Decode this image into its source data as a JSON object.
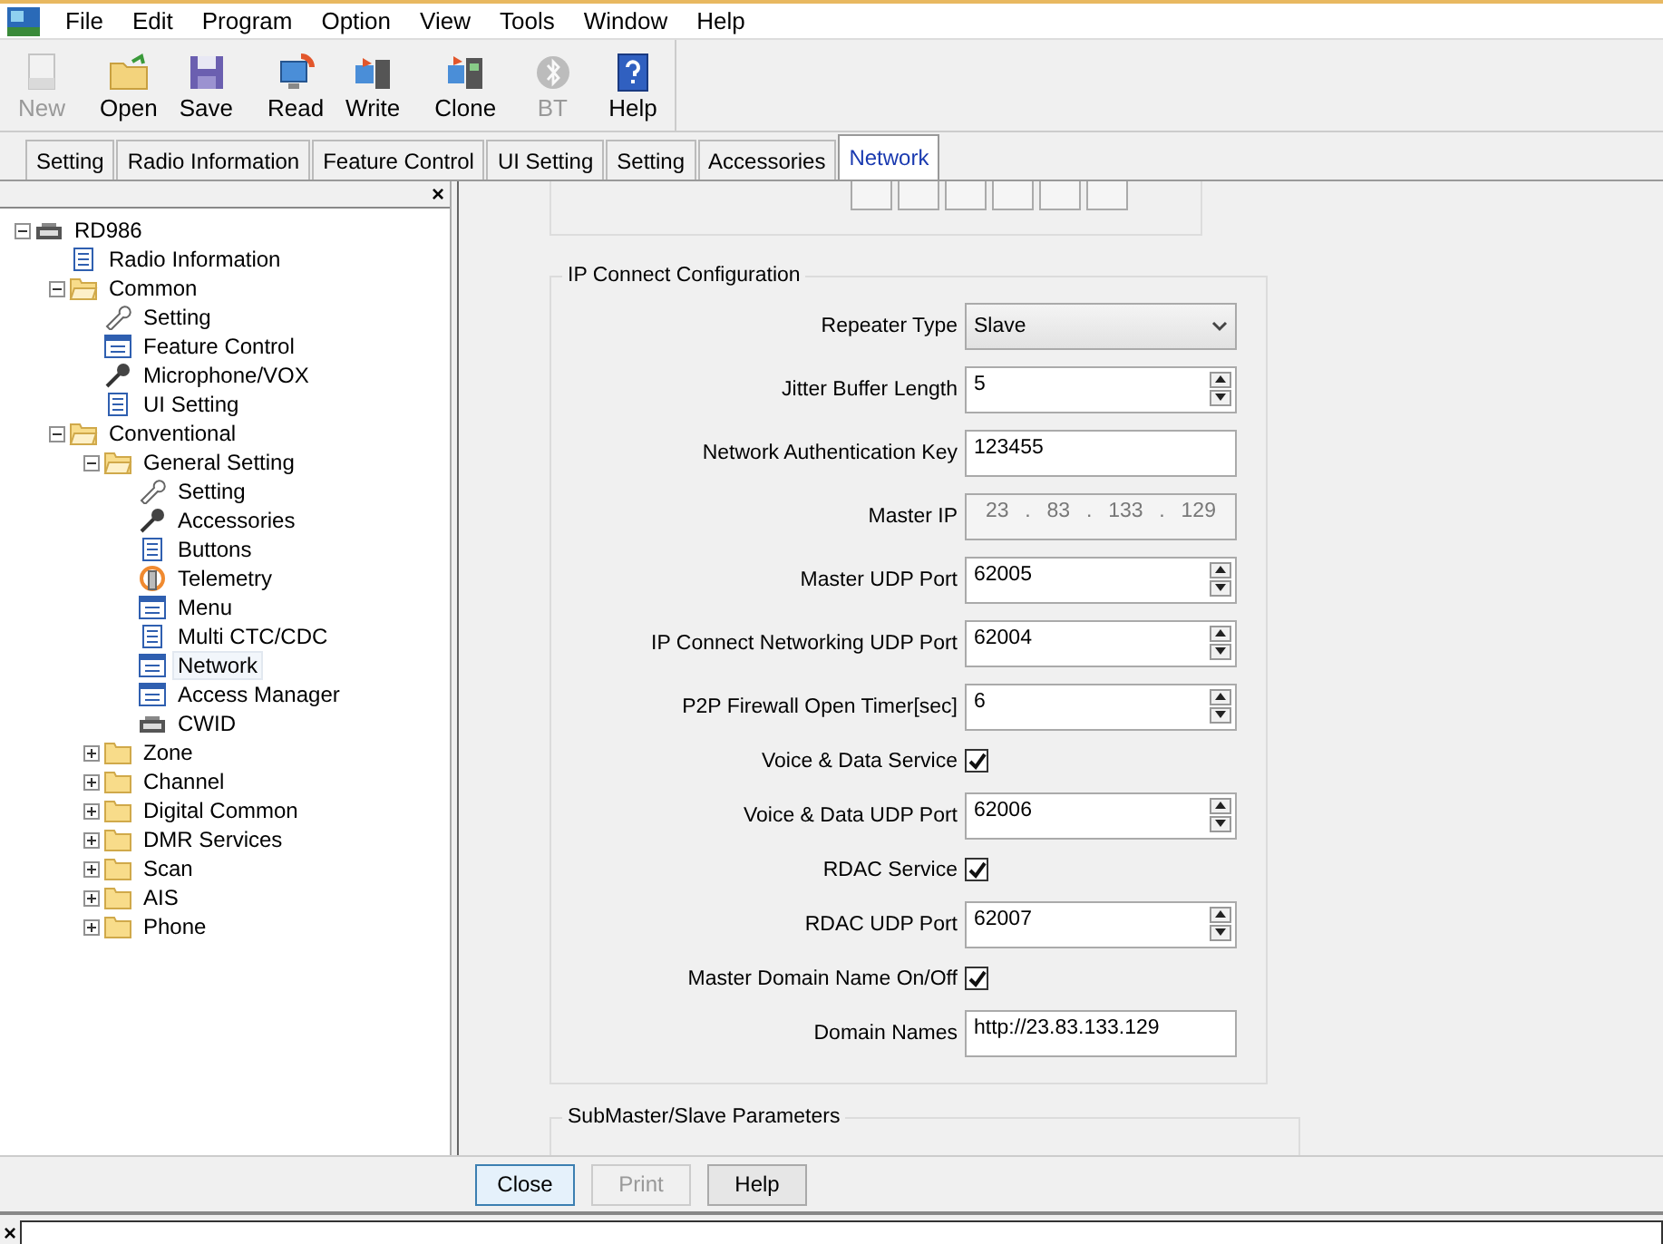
{
  "menu": [
    "File",
    "Edit",
    "Program",
    "Option",
    "View",
    "Tools",
    "Window",
    "Help"
  ],
  "toolbar": [
    {
      "label": "New",
      "disabled": true
    },
    {
      "label": "Open",
      "disabled": false
    },
    {
      "label": "Save",
      "disabled": false
    },
    {
      "label": "Read",
      "disabled": false
    },
    {
      "label": "Write",
      "disabled": false
    },
    {
      "label": "Clone",
      "disabled": false
    },
    {
      "label": "BT",
      "disabled": true
    },
    {
      "label": "Help",
      "disabled": false
    }
  ],
  "tabs": [
    {
      "label": "Setting",
      "selected": false
    },
    {
      "label": "Radio Information",
      "selected": false
    },
    {
      "label": "Feature Control",
      "selected": false
    },
    {
      "label": "UI Setting",
      "selected": false
    },
    {
      "label": "Setting",
      "selected": false
    },
    {
      "label": "Accessories",
      "selected": false
    },
    {
      "label": "Network",
      "selected": true
    }
  ],
  "tree_panel": {
    "close": "×",
    "items": [
      {
        "label": "RD986",
        "kind": "device",
        "expanded": true,
        "selected": false,
        "children": [
          {
            "label": "Radio Information",
            "kind": "page",
            "selected": false
          },
          {
            "label": "Common",
            "kind": "folder",
            "expanded": true,
            "selected": false,
            "children": [
              {
                "label": "Setting",
                "kind": "wrench",
                "selected": false
              },
              {
                "label": "Feature Control",
                "kind": "list",
                "selected": false
              },
              {
                "label": "Microphone/VOX",
                "kind": "mic",
                "selected": false
              },
              {
                "label": "UI Setting",
                "kind": "page",
                "selected": false
              }
            ]
          },
          {
            "label": "Conventional",
            "kind": "folder",
            "expanded": true,
            "selected": false,
            "children": [
              {
                "label": "General Setting",
                "kind": "folder",
                "expanded": true,
                "selected": false,
                "children": [
                  {
                    "label": "Setting",
                    "kind": "wrench",
                    "selected": false
                  },
                  {
                    "label": "Accessories",
                    "kind": "mic",
                    "selected": false
                  },
                  {
                    "label": "Buttons",
                    "kind": "page",
                    "selected": false
                  },
                  {
                    "label": "Telemetry",
                    "kind": "signal",
                    "selected": false
                  },
                  {
                    "label": "Menu",
                    "kind": "list",
                    "selected": false
                  },
                  {
                    "label": "Multi CTC/CDC",
                    "kind": "page",
                    "selected": false
                  },
                  {
                    "label": "Network",
                    "kind": "list",
                    "selected": true
                  },
                  {
                    "label": "Access Manager",
                    "kind": "list",
                    "selected": false
                  },
                  {
                    "label": "CWID",
                    "kind": "device",
                    "selected": false
                  }
                ]
              },
              {
                "label": "Zone",
                "kind": "folder",
                "expanded": false,
                "selected": false
              },
              {
                "label": "Channel",
                "kind": "folder",
                "expanded": false,
                "selected": false
              },
              {
                "label": "Digital Common",
                "kind": "folder",
                "expanded": false,
                "selected": false
              },
              {
                "label": "DMR Services",
                "kind": "folder",
                "expanded": false,
                "selected": false
              },
              {
                "label": "Scan",
                "kind": "folder",
                "expanded": false,
                "selected": false
              },
              {
                "label": "AIS",
                "kind": "folder",
                "expanded": false,
                "selected": false
              },
              {
                "label": "Phone",
                "kind": "folder",
                "expanded": false,
                "selected": false
              }
            ]
          }
        ]
      }
    ]
  },
  "ip_connect": {
    "title": "IP Connect Configuration",
    "rows": [
      {
        "kind": "dropdown",
        "label": "Repeater Type",
        "value": "Slave"
      },
      {
        "kind": "spin",
        "label": "Jitter Buffer Length",
        "value": "5"
      },
      {
        "kind": "text",
        "label": "Network Authentication Key",
        "value": "123455"
      },
      {
        "kind": "ip",
        "label": "Master IP",
        "octets": [
          "23",
          "83",
          "133",
          "129"
        ],
        "separator": ".",
        "disabled": true
      },
      {
        "kind": "spin",
        "label": "Master UDP Port",
        "value": "62005"
      },
      {
        "kind": "spin",
        "label": "IP Connect Networking UDP Port",
        "value": "62004"
      },
      {
        "kind": "spin",
        "label": "P2P Firewall Open Timer[sec]",
        "value": "6"
      },
      {
        "kind": "checkbox",
        "label": "Voice & Data Service",
        "checked": true
      },
      {
        "kind": "spin",
        "label": "Voice & Data UDP Port",
        "value": "62006"
      },
      {
        "kind": "checkbox",
        "label": "RDAC Service",
        "checked": true
      },
      {
        "kind": "spin",
        "label": "RDAC UDP Port",
        "value": "62007"
      },
      {
        "kind": "checkbox",
        "label": "Master Domain Name On/Off",
        "checked": true
      },
      {
        "kind": "text",
        "label": "Domain Names",
        "value": "http://23.83.133.129"
      }
    ]
  },
  "submaster": {
    "title": "SubMaster/Slave Parameters"
  },
  "buttons": [
    {
      "label": "Close",
      "disabled": false,
      "default": true
    },
    {
      "label": "Print",
      "disabled": true,
      "default": false
    },
    {
      "label": "Help",
      "disabled": false,
      "default": false
    }
  ],
  "status_bar": {
    "close": "×"
  }
}
